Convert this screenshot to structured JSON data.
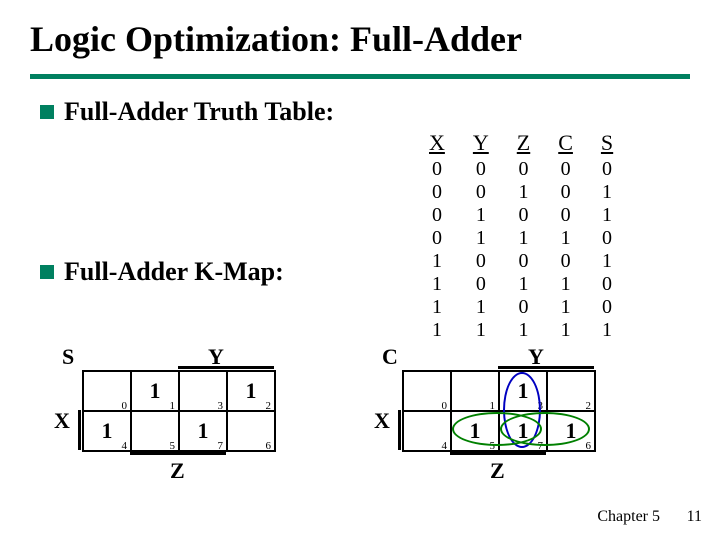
{
  "title": "Logic Optimization: Full-Adder",
  "bullets": {
    "truth": "Full-Adder Truth Table:",
    "kmap": "Full-Adder K-Map:"
  },
  "truth_table": {
    "headers": [
      "X",
      "Y",
      "Z",
      "C",
      "S"
    ],
    "rows": [
      [
        "0",
        "0",
        "0",
        "0",
        "0"
      ],
      [
        "0",
        "0",
        "1",
        "0",
        "1"
      ],
      [
        "0",
        "1",
        "0",
        "0",
        "1"
      ],
      [
        "0",
        "1",
        "1",
        "1",
        "0"
      ],
      [
        "1",
        "0",
        "0",
        "0",
        "1"
      ],
      [
        "1",
        "0",
        "1",
        "1",
        "0"
      ],
      [
        "1",
        "1",
        "0",
        "1",
        "0"
      ],
      [
        "1",
        "1",
        "1",
        "1",
        "1"
      ]
    ]
  },
  "kmaps": {
    "S": {
      "out_label": "S",
      "side_labels": {
        "Y": "Y",
        "X": "X",
        "Z": "Z"
      },
      "cells": [
        {
          "idx": "0",
          "val": ""
        },
        {
          "idx": "1",
          "val": "1"
        },
        {
          "idx": "3",
          "val": ""
        },
        {
          "idx": "2",
          "val": "1"
        },
        {
          "idx": "4",
          "val": "1"
        },
        {
          "idx": "5",
          "val": ""
        },
        {
          "idx": "7",
          "val": "1"
        },
        {
          "idx": "6",
          "val": ""
        }
      ]
    },
    "C": {
      "out_label": "C",
      "side_labels": {
        "Y": "Y",
        "X": "X",
        "Z": "Z"
      },
      "cells": [
        {
          "idx": "0",
          "val": ""
        },
        {
          "idx": "1",
          "val": ""
        },
        {
          "idx": "3",
          "val": "1"
        },
        {
          "idx": "2",
          "val": ""
        },
        {
          "idx": "4",
          "val": ""
        },
        {
          "idx": "5",
          "val": "1"
        },
        {
          "idx": "7",
          "val": "1"
        },
        {
          "idx": "6",
          "val": "1"
        }
      ],
      "groupings": [
        {
          "style": "v",
          "color": "#0000c0",
          "desc": "column idx 3,7"
        },
        {
          "style": "h1",
          "color": "#008000",
          "desc": "row2 idx 5,7"
        },
        {
          "style": "h2",
          "color": "#008000",
          "desc": "row2 idx 7,6"
        }
      ]
    }
  },
  "footer": {
    "chapter": "Chapter 5",
    "page": "11"
  },
  "chart_data": {
    "type": "table",
    "title": "Full-Adder Truth Table",
    "columns": [
      "X",
      "Y",
      "Z",
      "C",
      "S"
    ],
    "rows": [
      [
        0,
        0,
        0,
        0,
        0
      ],
      [
        0,
        0,
        1,
        0,
        1
      ],
      [
        0,
        1,
        0,
        0,
        1
      ],
      [
        0,
        1,
        1,
        1,
        0
      ],
      [
        1,
        0,
        0,
        0,
        1
      ],
      [
        1,
        0,
        1,
        1,
        0
      ],
      [
        1,
        1,
        0,
        1,
        0
      ],
      [
        1,
        1,
        1,
        1,
        1
      ]
    ]
  }
}
